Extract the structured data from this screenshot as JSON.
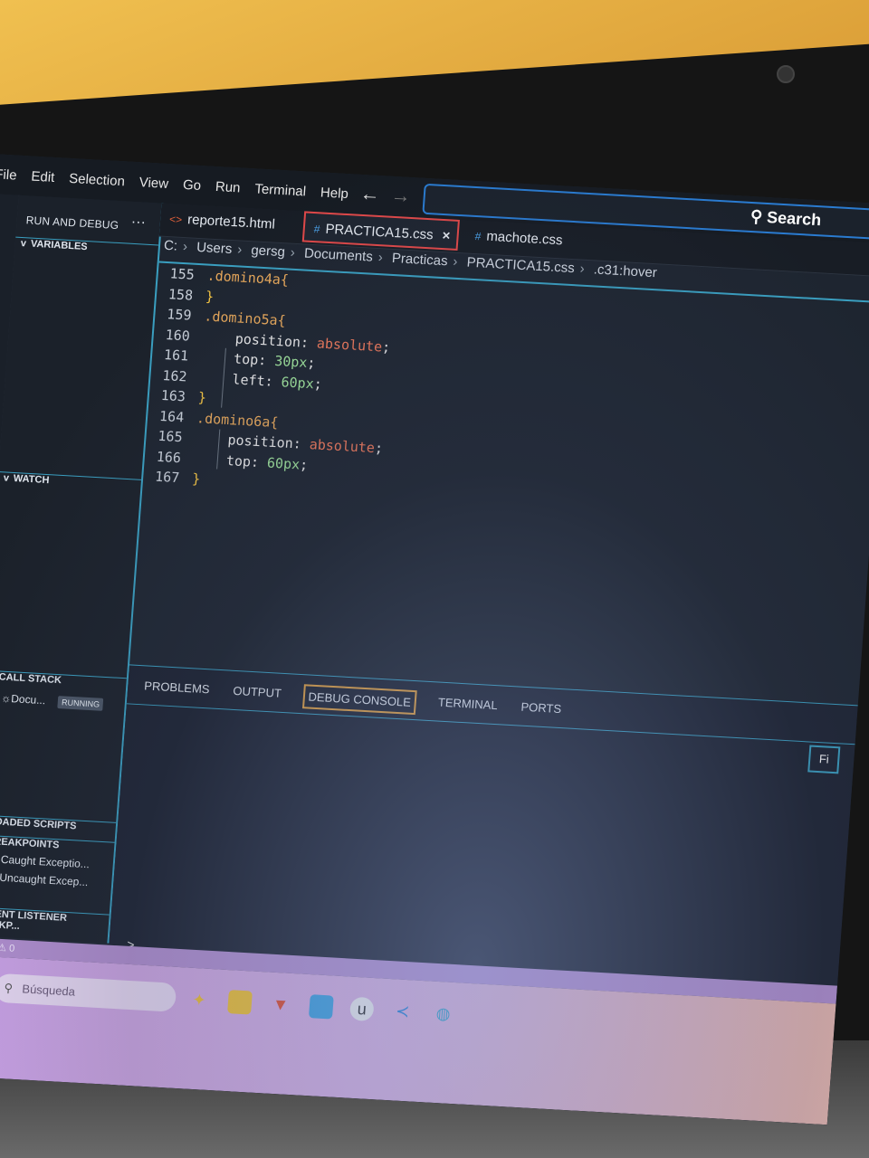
{
  "menu": [
    "File",
    "Edit",
    "Selection",
    "View",
    "Go",
    "Run",
    "Terminal",
    "Help"
  ],
  "search_label": "Search",
  "sidebar": {
    "title": "RUN AND DEBUG",
    "more": "···",
    "variables": "VARIABLES",
    "watch": "WATCH",
    "call_stack": "CALL STACK",
    "call_stack_item": "Docu...",
    "running": "RUNNING",
    "loaded_scripts": "LOADED SCRIPTS",
    "breakpoints": "BREAKPOINTS",
    "bp_caught": "Caught Exceptio...",
    "bp_uncaught": "Uncaught Excep...",
    "event_listener": "EVENT LISTENER BREAKP..."
  },
  "tabs": [
    {
      "label": "reporte15.html",
      "icon": "<>"
    },
    {
      "label": "PRACTICA15.css",
      "icon": "#",
      "close": "×"
    },
    {
      "label": "machote.css",
      "icon": "#"
    }
  ],
  "breadcrumb": [
    "C:",
    "Users",
    "gersg",
    "Documents",
    "Practicas",
    "PRACTICA15.css",
    ".c31:hover"
  ],
  "code": [
    {
      "n": "155",
      "t": ".domino4a{"
    },
    {
      "n": "158",
      "t": "}"
    },
    {
      "n": "159",
      "t": ".domino5a{"
    },
    {
      "n": "160",
      "p": "position: ",
      "v": "absolute",
      "k": "kw"
    },
    {
      "n": "161",
      "p": "top: ",
      "v": "30px",
      "k": "num"
    },
    {
      "n": "162",
      "p": "left: ",
      "v": "60px",
      "k": "num"
    },
    {
      "n": "163",
      "t": "}"
    },
    {
      "n": "164",
      "t": ".domino6a{"
    },
    {
      "n": "165",
      "p": "position: ",
      "v": "absolute",
      "k": "kw"
    },
    {
      "n": "166",
      "p": "top: ",
      "v": "60px",
      "k": "num"
    },
    {
      "n": "167",
      "t": "}"
    }
  ],
  "panel_tabs": [
    "PROBLEMS",
    "OUTPUT",
    "DEBUG CONSOLE",
    "TERMINAL",
    "PORTS"
  ],
  "panel_filter": "Fi",
  "panel_prompt": ">",
  "status": "⊗ 0 ⚠ 0",
  "taskbar": {
    "search_placeholder": "Búsqueda"
  }
}
